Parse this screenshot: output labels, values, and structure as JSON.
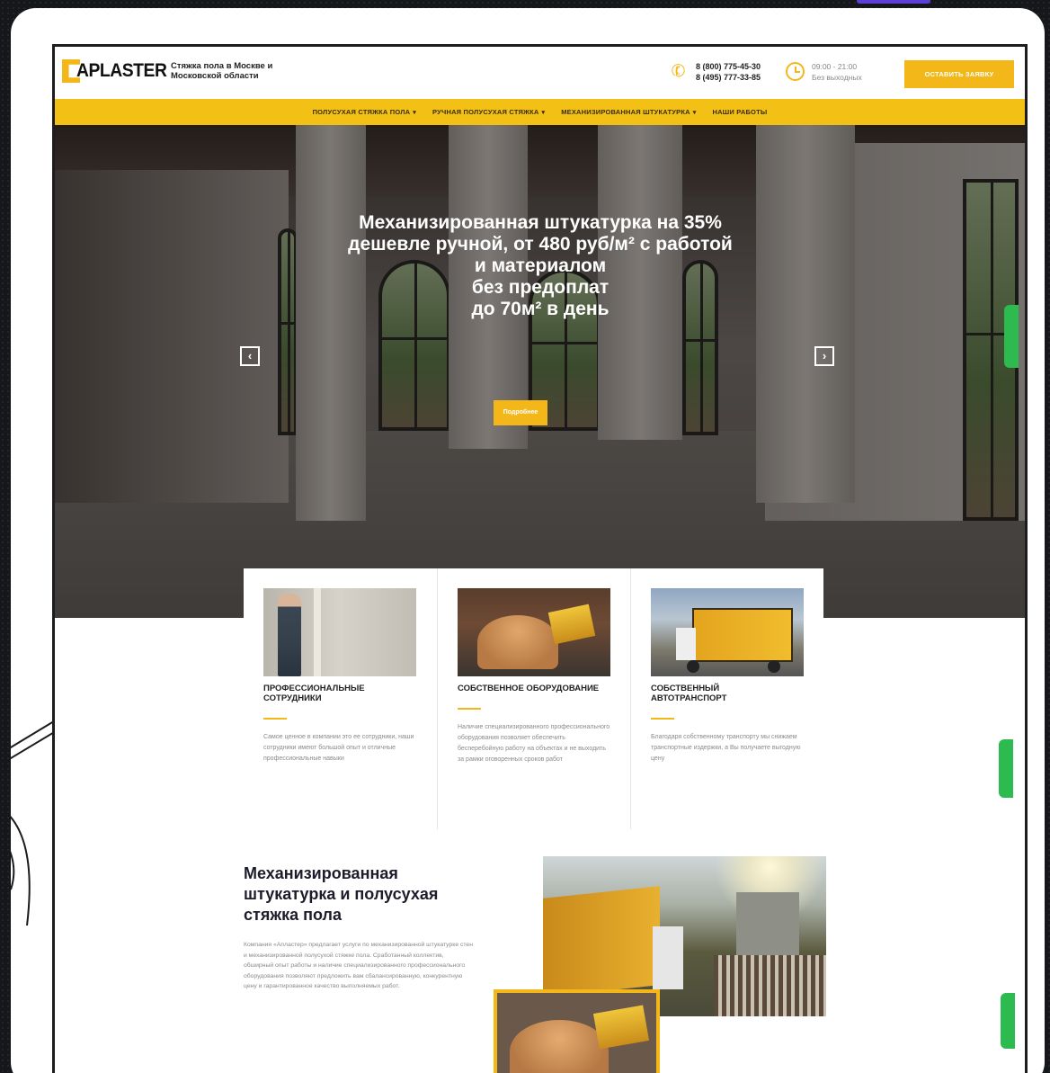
{
  "header": {
    "logo_text": "APLASTER",
    "tagline": "Стяжка пола в Москве и Московской области",
    "phone_1": "8 (800) 775-45-30",
    "phone_2": "8 (495) 777-33-85",
    "hours": "09:00 - 21:00",
    "hours_note": "Без выходных",
    "cta_label": "ОСТАВИТЬ ЗАЯВКУ"
  },
  "nav": {
    "items": [
      {
        "label": "ПОЛУСУХАЯ СТЯЖКА ПОЛА",
        "has_dropdown": true
      },
      {
        "label": "РУЧНАЯ ПОЛУСУХАЯ СТЯЖКА",
        "has_dropdown": true
      },
      {
        "label": "МЕХАНИЗИРОВАННАЯ ШТУКАТУРКА",
        "has_dropdown": true
      },
      {
        "label": "НАШИ РАБОТЫ",
        "has_dropdown": false
      }
    ]
  },
  "hero": {
    "title_line1": "Механизированная штукатурка на 35%",
    "title_line2": "дешевле ручной, от 480 руб/м² с работой",
    "title_line3": "и материалом",
    "title_line4": "без предоплат",
    "title_line5": "до 70м² в день",
    "button_label": "Подробнее",
    "prev_icon": "‹",
    "next_icon": "›"
  },
  "features": [
    {
      "title": "ПРОФЕССИОНАЛЬНЫЕ СОТРУДНИКИ",
      "text": "Самое ценное в компании это ее сотрудники, наши сотрудники имеют большой опыт и отличные профессиональные навыки"
    },
    {
      "title": "СОБСТВЕННОЕ ОБОРУДОВАНИЕ",
      "text": "Наличие специализированного профессионального оборудования позволяет обеспечить бесперебойную работу на объектах и не выходить за рамки оговоренных сроков работ"
    },
    {
      "title": "СОБСТВЕННЫЙ АВТОТРАНСПОРТ",
      "text": "Благодаря собственному транспорту мы снижаем транспортные издержки, а Вы получаете выгодную цену"
    }
  ],
  "about": {
    "title": "Механизированная штукатурка и полусухая стяжка пола",
    "text": "Компания «Апластер» предлагает услуги по механизированной штукатурке стен и механизированной полусухой стяжке пола. Сработанный коллектив, обширный опыт работы и наличие специализированного профессионального оборудования позволяют предложить вам сбалансированную, конкурентную цену и гарантированное качество выполняемых работ."
  },
  "colors": {
    "accent": "#f3b71a",
    "nav_bg": "#f3c016",
    "widget_green": "#2dbb4f",
    "frame_bg": "#16171a"
  }
}
